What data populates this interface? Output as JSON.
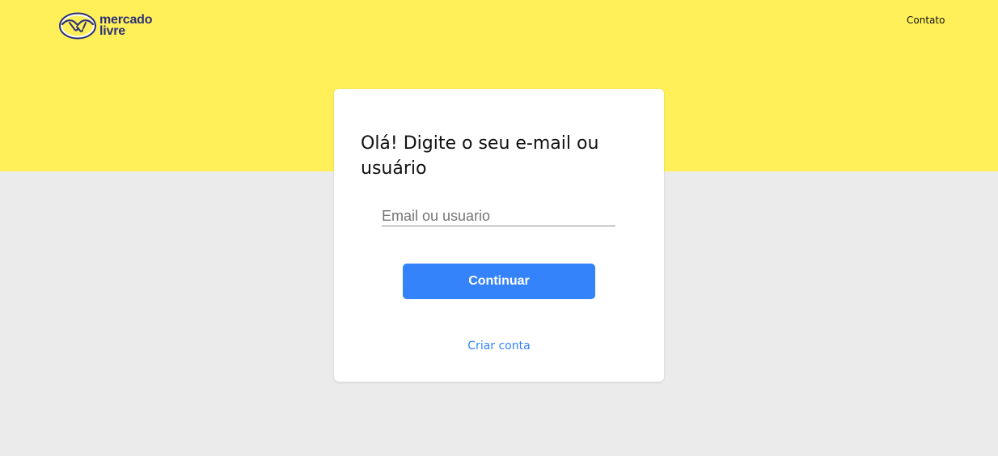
{
  "header": {
    "logo": {
      "line1": "mercado",
      "line2": "livre"
    },
    "contact_label": "Contato"
  },
  "login": {
    "title": "Olá! Digite o seu e-mail ou usuário",
    "input_placeholder": "Email ou usuario",
    "input_value": "",
    "continue_label": "Continuar",
    "create_account_label": "Criar conta"
  },
  "colors": {
    "header_background": "#fff059",
    "page_background": "#ebebeb",
    "primary_button": "#3483fa",
    "link": "#3483fa",
    "logo_text": "#2d3277"
  },
  "icons": {
    "logo": "mercado-livre-handshake-icon"
  }
}
